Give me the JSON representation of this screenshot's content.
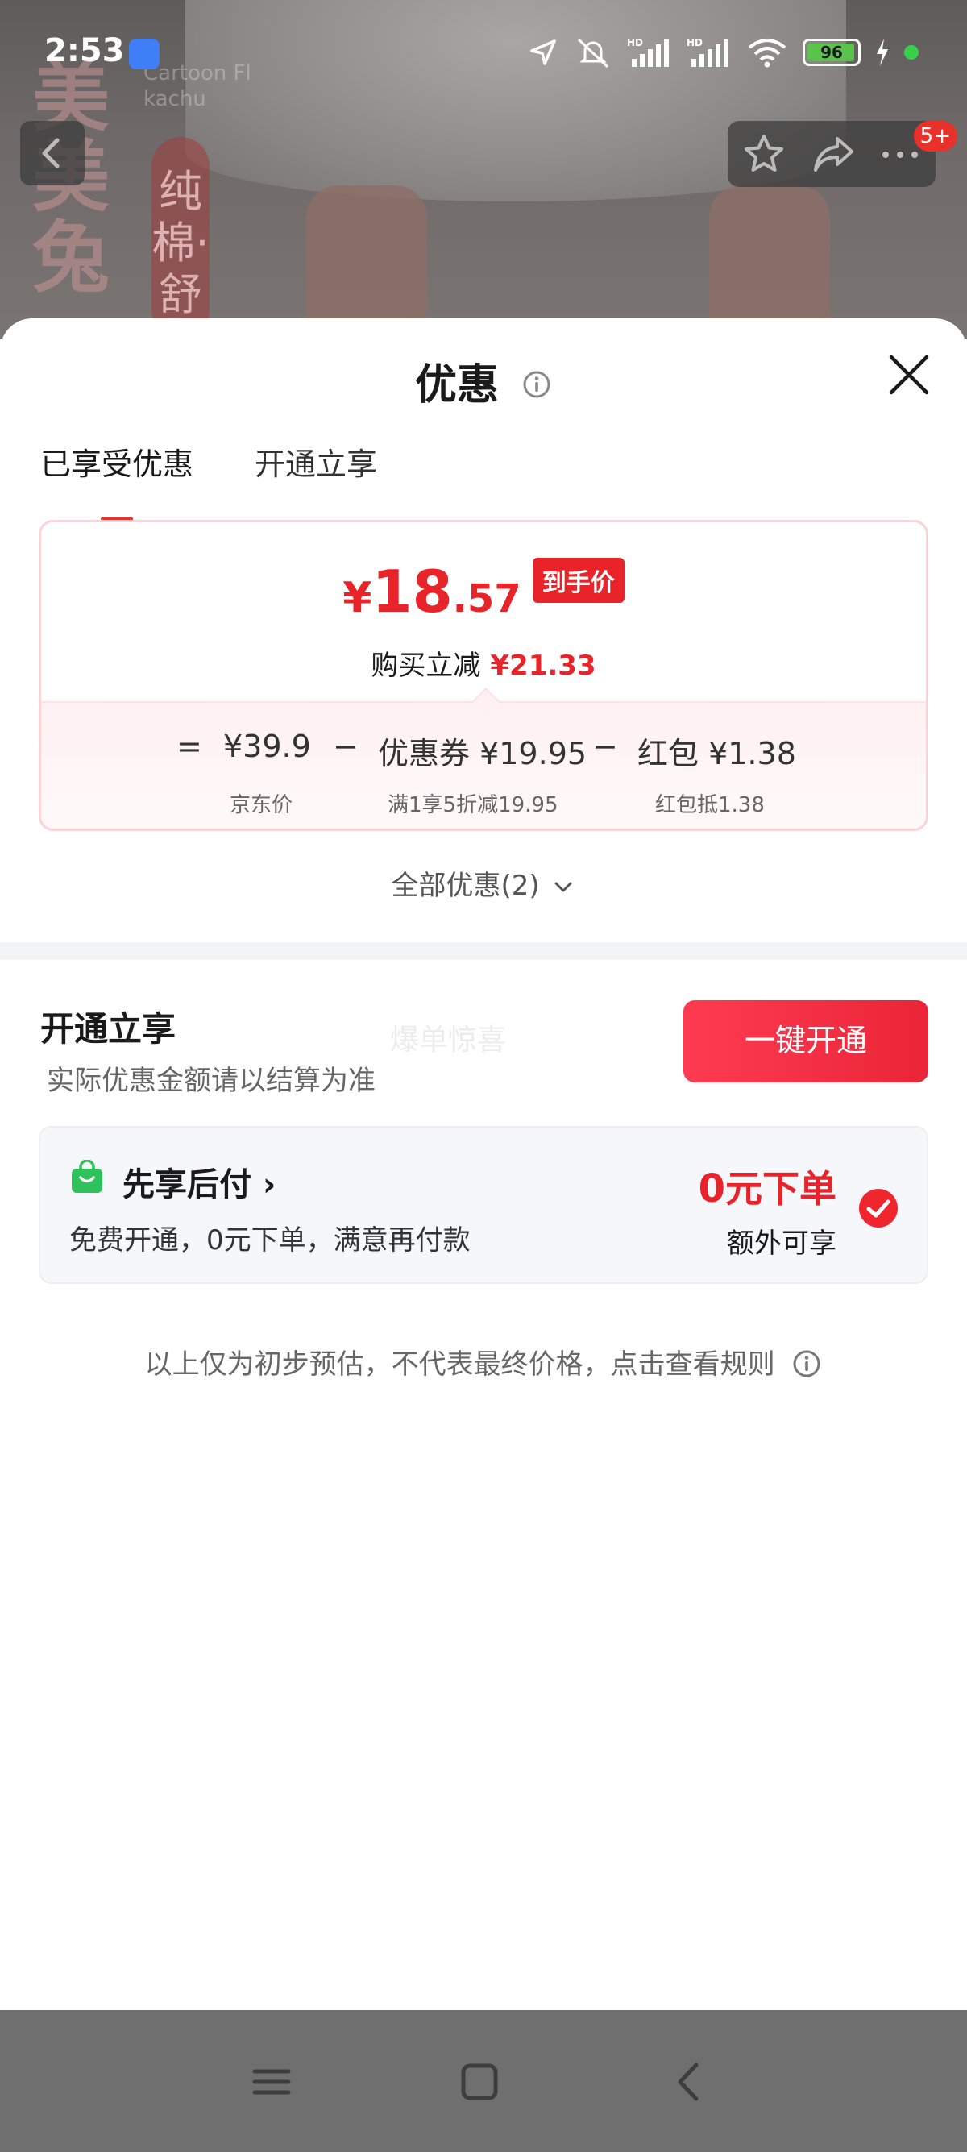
{
  "status_bar": {
    "time": "2:53",
    "battery": "96"
  },
  "background": {
    "brand_vertical": "美美兔",
    "tag_vertical": "纯棉·舒",
    "faint_text": "Cartoon Fl\nkachu"
  },
  "nav": {
    "badge": "5+"
  },
  "sheet": {
    "title": "优惠",
    "tabs": [
      {
        "label": "已享受优惠",
        "active": true
      },
      {
        "label": "开通立享",
        "active": false
      }
    ],
    "price": {
      "currency": "¥",
      "integer": "18",
      "decimal": ".57",
      "badge": "到手价",
      "instant_label": "购买立减",
      "instant_value": "¥21.33"
    },
    "formula": {
      "eq": "=",
      "jd_price": "¥39.9",
      "minus1": "−",
      "coupon": "优惠券 ¥19.95",
      "minus2": "−",
      "redpacket": "红包 ¥1.38",
      "jd_price_label": "京东价",
      "coupon_desc": "满1享5折减19.95",
      "redpacket_desc": "红包抵1.38"
    },
    "all_discount": "全部优惠(2)",
    "open_section": {
      "title": "开通立享",
      "subtitle": "实际优惠金额请以结算为准",
      "faint": "爆单惊喜",
      "button": "一键开通"
    },
    "bnpl": {
      "title": "先享后付 ›",
      "desc": "免费开通，0元下单，满意再付款",
      "zero_digit": "0",
      "zero_text": "元下单",
      "extra": "额外可享"
    },
    "disclaimer": "以上仅为初步预估，不代表最终价格，点击查看规则"
  },
  "colors": {
    "accent_red": "#e8232a",
    "button_red": "#ff3b52",
    "bnpl_green": "#2fc25b",
    "tab_underline": "#e8312a"
  }
}
